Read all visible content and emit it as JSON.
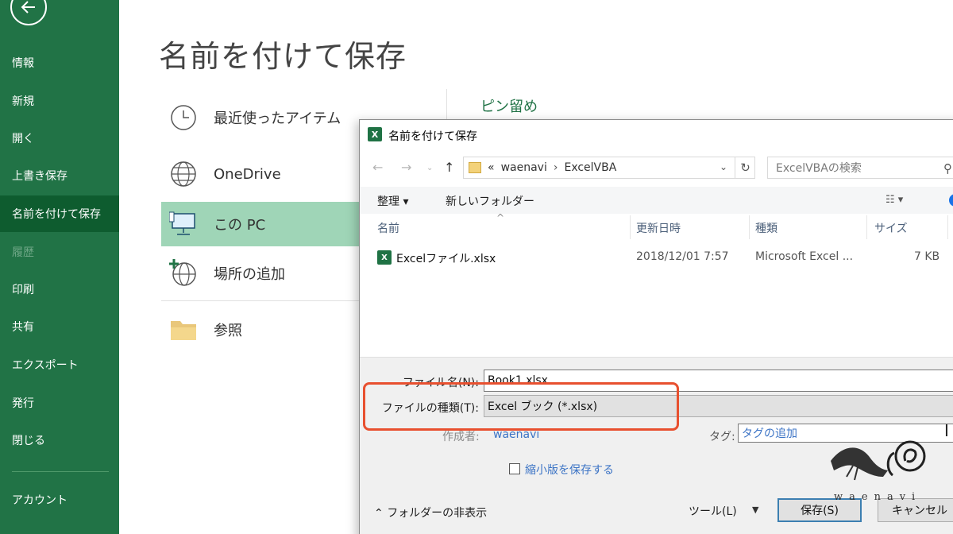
{
  "sidebar": {
    "items": [
      {
        "label": "情報"
      },
      {
        "label": "新規"
      },
      {
        "label": "開く"
      },
      {
        "label": "上書き保存"
      },
      {
        "label": "名前を付けて保存"
      },
      {
        "label": "履歴"
      },
      {
        "label": "印刷"
      },
      {
        "label": "共有"
      },
      {
        "label": "エクスポート"
      },
      {
        "label": "発行"
      },
      {
        "label": "閉じる"
      },
      {
        "label": "アカウント"
      }
    ]
  },
  "page": {
    "title": "名前を付けて保存",
    "locations": [
      {
        "label": "最近使ったアイテム",
        "icon": "clock-icon"
      },
      {
        "label": "OneDrive",
        "icon": "globe-icon"
      },
      {
        "label": "この PC",
        "icon": "computer-icon"
      },
      {
        "label": "場所の追加",
        "icon": "add-place-icon"
      },
      {
        "label": "参照",
        "icon": "folder-icon"
      }
    ],
    "pinned_label": "ピン留め"
  },
  "dialog": {
    "title": "名前を付けて保存",
    "address": {
      "prefix": "«",
      "crumbs": [
        "waenavi",
        "ExcelVBA"
      ]
    },
    "search_placeholder": "ExcelVBAの検索",
    "toolbar": {
      "organize": "整理 ▾",
      "new_folder": "新しいフォルダー"
    },
    "columns": [
      "名前",
      "更新日時",
      "種類",
      "サイズ"
    ],
    "files": [
      {
        "name": "Excelファイル.xlsx",
        "modified": "2018/12/01 7:57",
        "type": "Microsoft Excel ...",
        "size": "7 KB"
      }
    ],
    "filename_label": "ファイル名(N):",
    "filename_value": "Book1.xlsx",
    "filetype_label": "ファイルの種類(T):",
    "filetype_value": "Excel ブック (*.xlsx)",
    "author_label": "作成者:",
    "author_value": "waenavi",
    "tag_label": "タグ:",
    "tag_value": "タグの追加",
    "thumbnail_label": "縮小版を保存する",
    "hide_folders": "フォルダーの非表示",
    "tools": "ツール(L)",
    "save": "保存(S)",
    "cancel": "キャンセル"
  },
  "watermark": {
    "text": "waenavi"
  },
  "colors": {
    "sidebar": "#217346",
    "active_location": "#9fd5b7",
    "highlight": "#e8502f"
  }
}
